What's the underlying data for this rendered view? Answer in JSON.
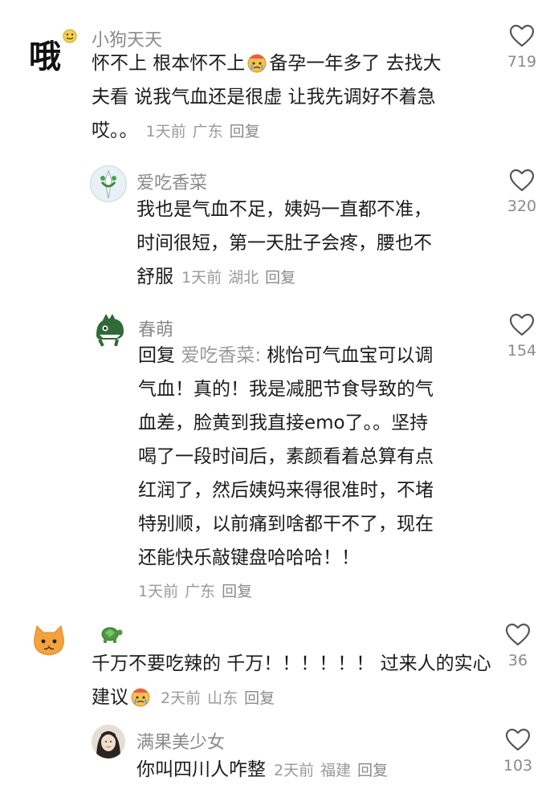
{
  "comments": [
    {
      "username": "小狗天天",
      "avatar_text": "哦",
      "lines": [
        "怀不上 根本怀不上",
        "备孕一年多了 去找大",
        "夫看 说我气血还是很虚 让我先调好不着急",
        "哎。。"
      ],
      "time": "1天前",
      "location": "广东",
      "reply_label": "回复",
      "likes": "719"
    },
    {
      "username": "爱吃香菜",
      "lines": [
        "我也是气血不足，姨妈一直都不准，",
        "时间很短，第一天肚子会疼，腰也不",
        "舒服"
      ],
      "time": "1天前",
      "location": "湖北",
      "reply_label": "回复",
      "likes": "320"
    },
    {
      "username": "春萌",
      "reply_prefix": "回复",
      "reply_to": "爱吃香菜:",
      "lines": [
        " 桃怡可气血宝可以调",
        "气血！真的！我是减肥节食导致的气",
        "血差，脸黄到我直接emo了。。坚持",
        "喝了一段时间后，素颜看着总算有点",
        "红润了，然后姨妈来得很准时，不堵",
        "特别顺，以前痛到啥都干不了，现在",
        "还能快乐敲键盘哈哈哈！！"
      ],
      "time": "1天前",
      "location": "广东",
      "reply_label": "回复",
      "likes": "154"
    },
    {
      "username": "",
      "lines": [
        "千万不要吃辣的 千万！！！！！！ 过来人的实心",
        "建议"
      ],
      "time": "2天前",
      "location": "山东",
      "reply_label": "回复",
      "likes": "36"
    },
    {
      "username": "满果美少女",
      "lines": [
        "你叫四川人咋整"
      ],
      "time": "2天前",
      "location": "福建",
      "reply_label": "回复",
      "likes": "103"
    }
  ]
}
